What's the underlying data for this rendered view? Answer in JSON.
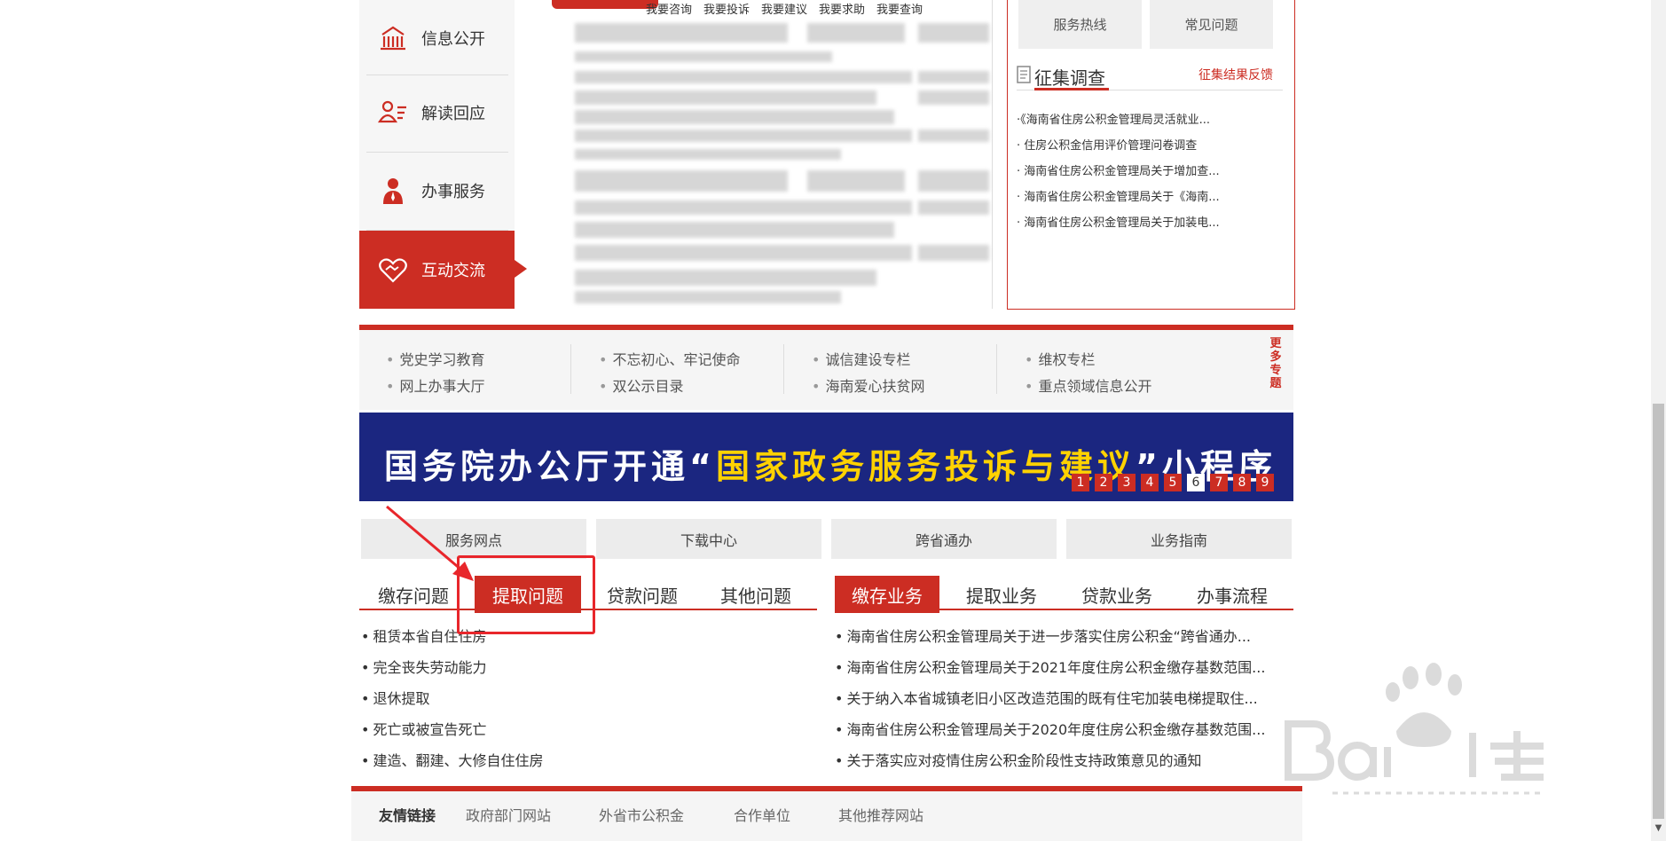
{
  "left_nav": {
    "items": [
      {
        "label": "信息公开",
        "icon": "building-icon",
        "active": false
      },
      {
        "label": "解读回应",
        "icon": "person-list-icon",
        "active": false
      },
      {
        "label": "办事服务",
        "icon": "person-tie-icon",
        "active": false
      },
      {
        "label": "互动交流",
        "icon": "heart-handshake-icon",
        "active": true
      }
    ]
  },
  "center_tabs": [
    "我要咨询",
    "我要投诉",
    "我要建议",
    "我要求助",
    "我要查询"
  ],
  "right_panel": {
    "buttons": [
      "服务热线",
      "常见问题"
    ],
    "section_title": "征集调查",
    "section_link": "征集结果反馈",
    "items": [
      "·《海南省住房公积金管理局灵活就业...",
      "· 住房公积金信用评价管理问卷调查",
      "· 海南省住房公积金管理局关于增加查...",
      "· 海南省住房公积金管理局关于《海南...",
      "· 海南省住房公积金管理局关于加装电..."
    ]
  },
  "topics": {
    "columns": [
      [
        "党史学习教育",
        "网上办事大厅"
      ],
      [
        "不忘初心、牢记使命",
        "双公示目录"
      ],
      [
        "诚信建设专栏",
        "海南爱心扶贫网"
      ],
      [
        "维权专栏",
        "重点领域信息公开"
      ]
    ],
    "more": "更多专题"
  },
  "banner": {
    "text_prefix": "国务院办公厅开通“",
    "text_highlight": "国家政务服务投诉与建议",
    "text_suffix": "”小程序",
    "pages": [
      "1",
      "2",
      "3",
      "4",
      "5",
      "6",
      "7",
      "8",
      "9"
    ],
    "active_page": "6"
  },
  "quick_buttons": [
    "服务网点",
    "下载中心",
    "跨省通办",
    "业务指南"
  ],
  "left_tabs": {
    "labels": [
      "缴存问题",
      "提取问题",
      "贷款问题",
      "其他问题"
    ],
    "active": "提取问题",
    "items": [
      "租赁本省自住住房",
      "完全丧失劳动能力",
      "退休提取",
      "死亡或被宣告死亡",
      "建造、翻建、大修自住住房"
    ]
  },
  "right_tabs": {
    "labels": [
      "缴存业务",
      "提取业务",
      "贷款业务",
      "办事流程"
    ],
    "active": "缴存业务",
    "items": [
      "海南省住房公积金管理局关于进一步落实住房公积金“跨省通办...",
      "海南省住房公积金管理局关于2021年度住房公积金缴存基数范围...",
      "关于纳入本省城镇老旧小区改造范围的既有住宅加装电梯提取住...",
      "海南省住房公积金管理局关于2020年度住房公积金缴存基数范围...",
      "关于落实应对疫情住房公积金阶段性支持政策意见的通知"
    ]
  },
  "footer": {
    "label": "友情链接",
    "links": [
      "政府部门网站",
      "外省市公积金",
      "合作单位",
      "其他推荐网站"
    ]
  },
  "colors": {
    "brand_red": "#cc2d23",
    "banner_blue": "#1b2680",
    "banner_yellow": "#ffd200"
  }
}
